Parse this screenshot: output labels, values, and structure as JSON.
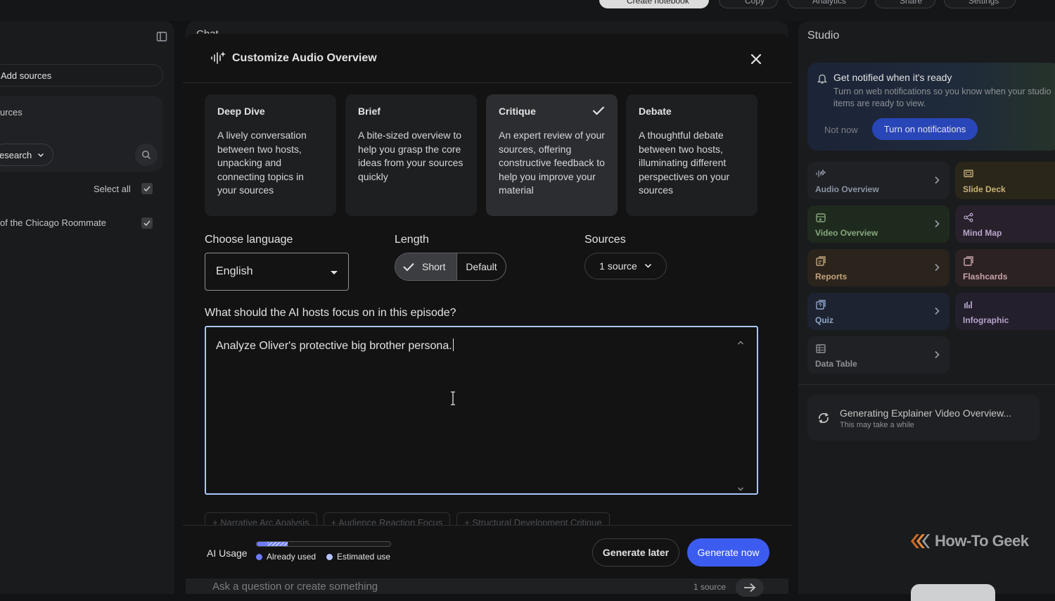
{
  "topbar": {
    "buttons": [
      "Create notebook",
      "Copy",
      "Analytics",
      "Share",
      "Settings"
    ]
  },
  "left_panel": {
    "add_sources": "Add sources",
    "sources_label": "urces",
    "research_label": "esearch",
    "select_all": "Select all",
    "source_item": "of the Chicago Roommate"
  },
  "chat_panel": {
    "title": "Chat",
    "ask_placeholder": "Ask a question or create something",
    "source_count": "1 source"
  },
  "modal": {
    "title": "Customize Audio Overview",
    "formats": [
      {
        "name": "Deep Dive",
        "desc": "A lively conversation between two hosts, unpacking and connecting topics in your sources",
        "selected": false
      },
      {
        "name": "Brief",
        "desc": "A bite-sized overview to help you grasp the core ideas from your sources quickly",
        "selected": false
      },
      {
        "name": "Critique",
        "desc": "An expert review of your sources, offering constructive feedback to help you improve your material",
        "selected": true
      },
      {
        "name": "Debate",
        "desc": "A thoughtful debate between two hosts, illuminating different perspectives on your sources",
        "selected": false
      }
    ],
    "language_label": "Choose language",
    "language_value": "English",
    "length_label": "Length",
    "length_options": [
      "Short",
      "Default"
    ],
    "length_selected": "Short",
    "sources_label": "Sources",
    "sources_value": "1 source",
    "focus_label": "What should the AI hosts focus on in this episode?",
    "focus_value": "Analyze Oliver's protective big brother persona.",
    "suggestion_chips": [
      "+ Narrative Arc Analysis",
      "+ Audience Reaction Focus",
      "+ Structural Development Critique"
    ],
    "ai_usage": {
      "label": "AI Usage",
      "already_used_label": "Already used",
      "estimated_label": "Estimated use",
      "already_used_fraction": 0.08,
      "estimated_fraction": 0.15,
      "used_color": "#6f7cf7",
      "estimated_color": "#b7c3ff"
    },
    "generate_later": "Generate later",
    "generate_now": "Generate now"
  },
  "studio": {
    "title": "Studio",
    "notification": {
      "title": "Get notified when it's ready",
      "desc": "Turn on web notifications so you know when your studio items are ready to view.",
      "not_now": "Not now",
      "turn_on": "Turn on notifications"
    },
    "tiles": [
      {
        "label": "Audio Overview",
        "icon": "audio-wave-icon",
        "color": "#8d93a3",
        "bg": "#1f2125"
      },
      {
        "label": "Slide Deck",
        "icon": "slides-icon",
        "color": "#c9b27a",
        "bg": "#2a2619"
      },
      {
        "label": "Video Overview",
        "icon": "video-icon",
        "color": "#86a87e",
        "bg": "#1f2a1e"
      },
      {
        "label": "Mind Map",
        "icon": "mind-map-icon",
        "color": "#b8a3c9",
        "bg": "#28212c"
      },
      {
        "label": "Reports",
        "icon": "report-icon",
        "color": "#c4a47c",
        "bg": "#2a241c"
      },
      {
        "label": "Flashcards",
        "icon": "flashcards-icon",
        "color": "#c9a3a8",
        "bg": "#2c2224"
      },
      {
        "label": "Quiz",
        "icon": "quiz-icon",
        "color": "#8fa6c9",
        "bg": "#1d2330"
      },
      {
        "label": "Infographic",
        "icon": "infographic-icon",
        "color": "#b3a3c9",
        "bg": "#241f2d"
      },
      {
        "label": "Data Table",
        "icon": "table-icon",
        "color": "#8e9194",
        "bg": "#202124"
      }
    ],
    "generating": {
      "title": "Generating Explainer Video Overview...",
      "subtitle": "This may take a while"
    },
    "watermark": "How-To Geek"
  }
}
